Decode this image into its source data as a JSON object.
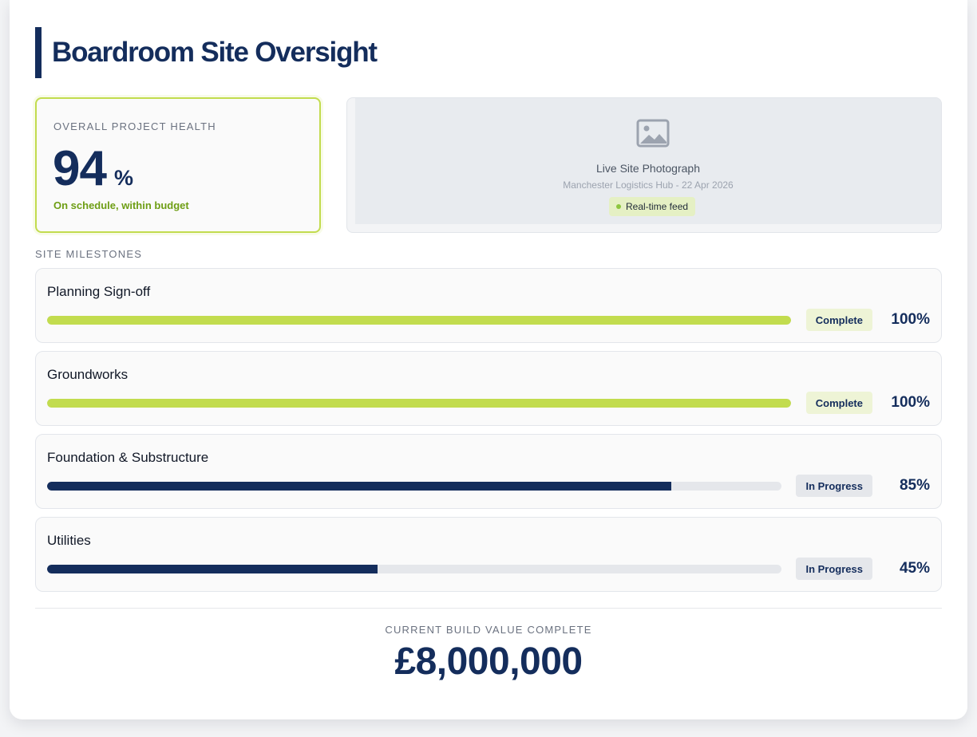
{
  "header": {
    "title": "Boardroom Site Oversight"
  },
  "health": {
    "label": "OVERALL PROJECT HEALTH",
    "value": "94",
    "unit": "%",
    "status": "On schedule, within budget",
    "accent": "#c2dc4e"
  },
  "photo": {
    "icon": "image-icon",
    "title": "Live Site Photograph",
    "subtitle": "Manchester Logistics Hub - 22 Apr 2026",
    "badge": "Real-time feed"
  },
  "milestones_section": {
    "label": "SITE MILESTONES"
  },
  "milestones": [
    {
      "name": "Planning Sign-off",
      "status": "Complete",
      "percent_label": "100%",
      "progress": 1.0,
      "bar_color": "#c2dc4e",
      "badge_bg": "#eef4d6",
      "badge_color": "#142d5c"
    },
    {
      "name": "Groundworks",
      "status": "Complete",
      "percent_label": "100%",
      "progress": 1.0,
      "bar_color": "#c2dc4e",
      "badge_bg": "#eef4d6",
      "badge_color": "#142d5c"
    },
    {
      "name": "Foundation & Substructure",
      "status": "In Progress",
      "percent_label": "85%",
      "progress": 0.85,
      "bar_color": "#142d5c",
      "badge_bg": "#e5e7eb",
      "badge_color": "#142d5c"
    },
    {
      "name": "Utilities",
      "status": "In Progress",
      "percent_label": "45%",
      "progress": 0.45,
      "bar_color": "#142d5c",
      "badge_bg": "#e5e7eb",
      "badge_color": "#142d5c"
    }
  ],
  "build_value": {
    "label": "CURRENT BUILD VALUE COMPLETE",
    "value": "£8,000,000"
  }
}
